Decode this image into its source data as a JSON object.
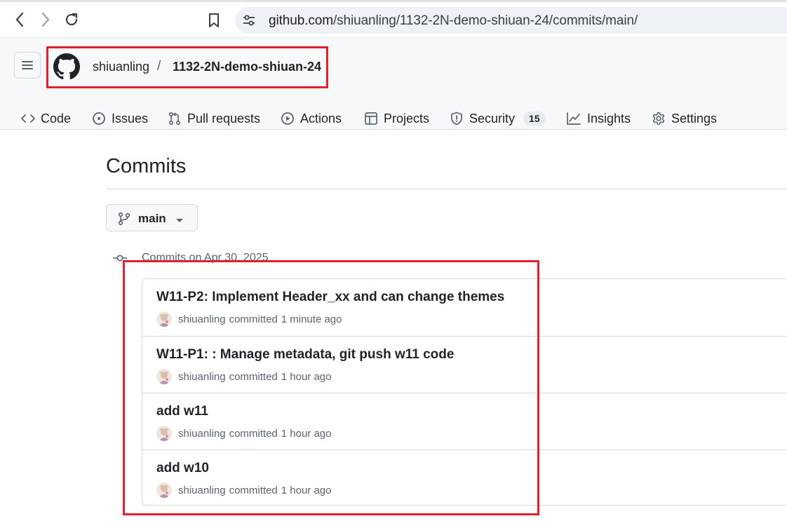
{
  "browser": {
    "url_host": "github.com",
    "url_path": "/shiuanling/1132-2N-demo-shiuan-24/commits/main/"
  },
  "repo": {
    "owner": "shiuanling",
    "separator": "/",
    "name": "1132-2N-demo-shiuan-24"
  },
  "tabs": [
    {
      "label": "Code",
      "icon": "code-icon"
    },
    {
      "label": "Issues",
      "icon": "issue-opened-icon"
    },
    {
      "label": "Pull requests",
      "icon": "git-pull-request-icon"
    },
    {
      "label": "Actions",
      "icon": "play-icon"
    },
    {
      "label": "Projects",
      "icon": "table-icon"
    },
    {
      "label": "Security",
      "icon": "shield-icon",
      "counter": "15"
    },
    {
      "label": "Insights",
      "icon": "graph-icon"
    },
    {
      "label": "Settings",
      "icon": "gear-icon"
    }
  ],
  "page": {
    "title": "Commits",
    "branch": "main",
    "group_label": "Commits on Apr 30, 2025"
  },
  "commits": [
    {
      "message": "W11-P2: Implement Header_xx and can change themes",
      "author": "shiuanling",
      "verb": "committed",
      "time": "1 minute ago"
    },
    {
      "message": "W11-P1: : Manage metadata, git push w11 code",
      "author": "shiuanling",
      "verb": "committed",
      "time": "1 hour ago"
    },
    {
      "message": "add w11",
      "author": "shiuanling",
      "verb": "committed",
      "time": "1 hour ago"
    },
    {
      "message": "add w10",
      "author": "shiuanling",
      "verb": "committed",
      "time": "1 hour ago"
    }
  ],
  "colors": {
    "highlight": "#e0202a",
    "border": "#d1d9e0",
    "header_bg": "#f6f8fa",
    "muted_text": "#59636e"
  }
}
